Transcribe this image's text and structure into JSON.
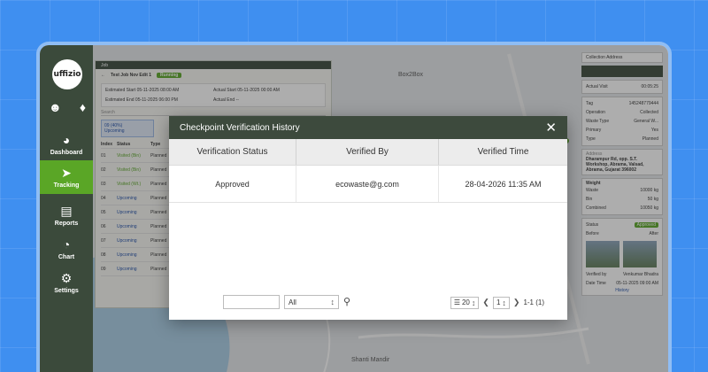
{
  "app": {
    "logo_text": "uffizio"
  },
  "sidebar": {
    "items": [
      {
        "label": "Dashboard",
        "icon": "speedometer-icon"
      },
      {
        "label": "Tracking",
        "icon": "tracking-icon"
      },
      {
        "label": "Reports",
        "icon": "report-icon"
      },
      {
        "label": "Chart",
        "icon": "pie-chart-icon"
      },
      {
        "label": "Settings",
        "icon": "gear-icon"
      }
    ]
  },
  "map": {
    "labels": [
      "Box2Box",
      "Shanti Mandir"
    ]
  },
  "job_panel": {
    "tab_label": "Job",
    "title": "Test Job Nov Edit 1",
    "status": "Running",
    "estimated_start_label": "Estimated Start",
    "estimated_start": "05-11-2025 08:00 AM",
    "estimated_end_label": "Estimated End",
    "estimated_end": "05-11-2025 06:00 PM",
    "actual_start_label": "Actual Start",
    "actual_start": "05-11-2025 00:00 AM",
    "actual_end_label": "Actual End",
    "actual_end": "--",
    "search_placeholder": "Search",
    "card_line1": "09 (40%)",
    "card_line2": "Upcoming",
    "columns": [
      "Index",
      "Status",
      "Type"
    ],
    "rows": [
      {
        "index": "01",
        "status": "Visited (Bin)",
        "type": "Planned"
      },
      {
        "index": "02",
        "status": "Visited (Bin)",
        "type": "Planned"
      },
      {
        "index": "03",
        "status": "Visited (Wt.)",
        "type": "Planned"
      },
      {
        "index": "04",
        "status": "Upcoming",
        "type": "Planned"
      },
      {
        "index": "05",
        "status": "Upcoming",
        "type": "Planned"
      },
      {
        "index": "06",
        "status": "Upcoming",
        "type": "Planned"
      },
      {
        "index": "07",
        "status": "Upcoming",
        "type": "Planned"
      },
      {
        "index": "08",
        "status": "Upcoming",
        "type": "Planned"
      },
      {
        "index": "09",
        "status": "Upcoming",
        "type": "Planned"
      }
    ]
  },
  "detail_panel": {
    "collection_address_label": "Collection Address",
    "kv": [
      {
        "k": "Actual Visit",
        "v": "00:05:25"
      },
      {
        "k": "Tag",
        "v": "145248779444"
      },
      {
        "k": "Operation",
        "v": "Collected"
      },
      {
        "k": "Waste Type",
        "v": "General W..."
      },
      {
        "k": "Primary",
        "v": "Yes"
      },
      {
        "k": "Type",
        "v": "Planned"
      }
    ],
    "address_label": "Address",
    "address": "Dharampur Rd, opp. S.T. Workshop, Abrama, Valsad, Abrama, Gujarat 396002",
    "weight_label": "Weight",
    "weight_kv": [
      {
        "k": "Waste",
        "v": "10000 kg"
      },
      {
        "k": "Bin",
        "v": "50 kg"
      },
      {
        "k": "Combined",
        "v": "10050 kg"
      }
    ],
    "status_label": "Status",
    "status_value": "Approved",
    "before_label": "Before",
    "after_label": "After",
    "verified_by_label": "Verified by",
    "verified_by": "Venkumar Bhadra",
    "date_time_label": "Date Time",
    "date_time": "05-11-2025 09:00 AM",
    "history_label": "History"
  },
  "modal": {
    "title": "Checkpoint Verification History",
    "columns": [
      "Verification Status",
      "Verified By",
      "Verified Time"
    ],
    "rows": [
      {
        "status": "Approved",
        "verified_by": "ecowaste@g.com",
        "verified_time": "28-04-2026 11:35 AM"
      }
    ],
    "search_value": "",
    "filter_value": "All",
    "page_size": "20",
    "page": "1",
    "range": "1-1 (1)"
  },
  "colors": {
    "accent": "#5aa626",
    "sidebar": "#3b4a3b",
    "background": "#3f8ff0"
  }
}
